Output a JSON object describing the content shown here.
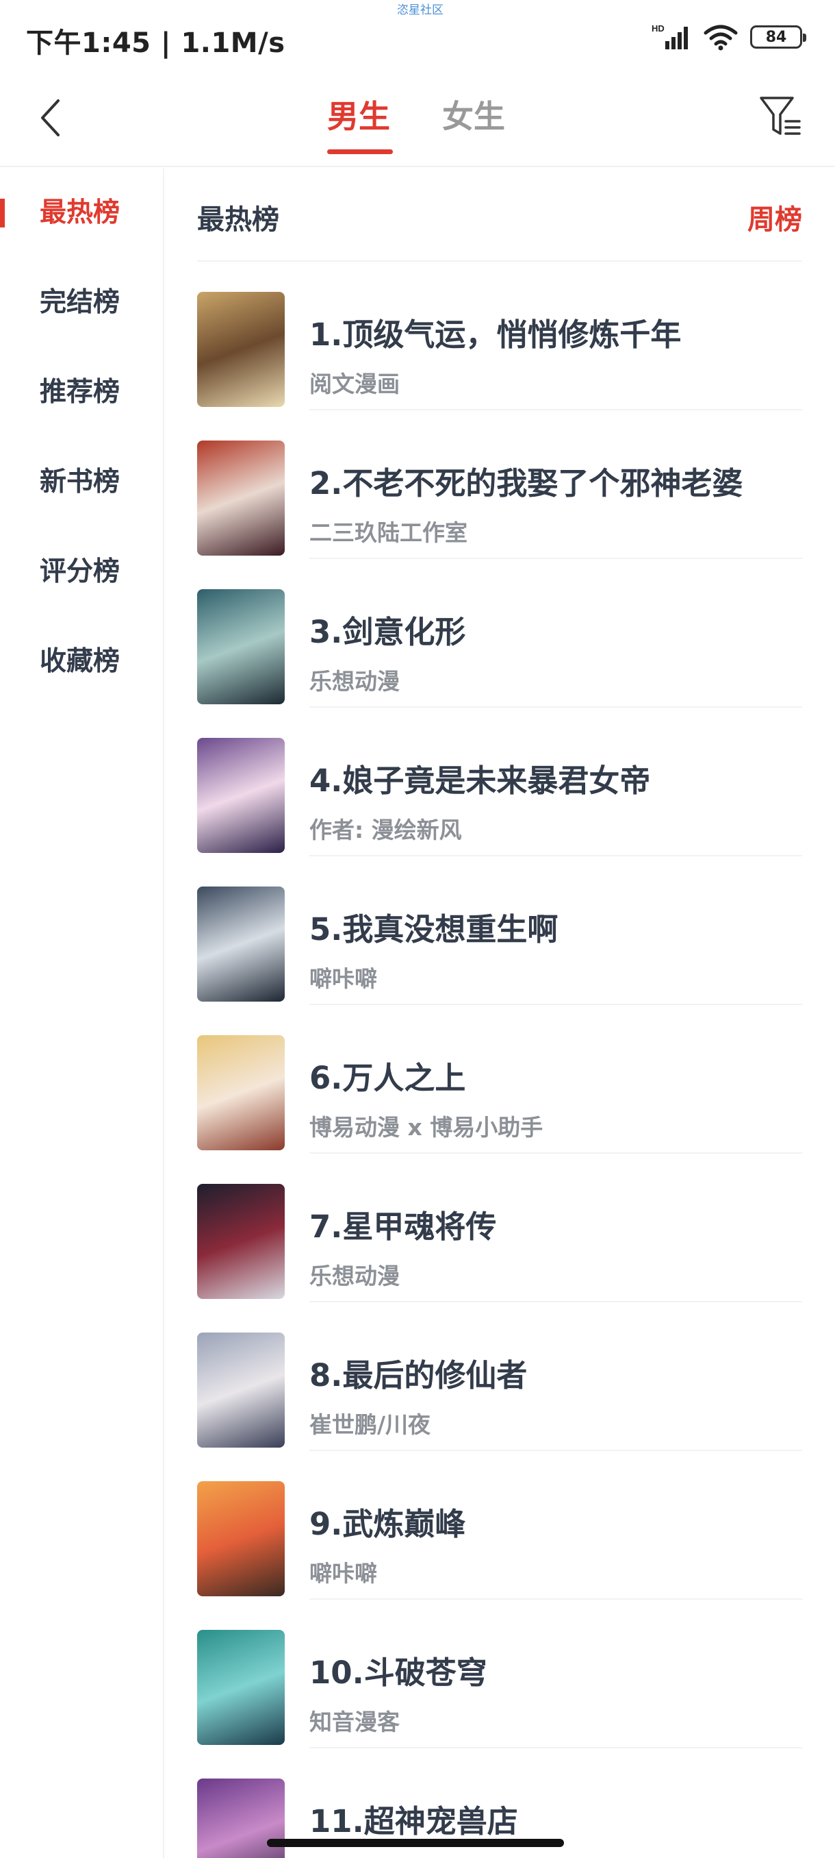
{
  "status_bar": {
    "watermark": "恣星社区",
    "time": "下午1:45 | 1.1M/s",
    "network": "HD",
    "battery": "84"
  },
  "header": {
    "tabs": [
      {
        "label": "男生",
        "active": true
      },
      {
        "label": "女生",
        "active": false
      }
    ],
    "back_icon": "chevron-left-icon",
    "filter_icon": "filter-icon"
  },
  "sidebar": {
    "items": [
      {
        "label": "最热榜",
        "active": true
      },
      {
        "label": "完结榜",
        "active": false
      },
      {
        "label": "推荐榜",
        "active": false
      },
      {
        "label": "新书榜",
        "active": false
      },
      {
        "label": "评分榜",
        "active": false
      },
      {
        "label": "收藏榜",
        "active": false
      }
    ]
  },
  "content": {
    "title": "最热榜",
    "period_label": "周榜"
  },
  "accent_color": "#e03a2f",
  "list": [
    {
      "title": "1.顶级气运，悄悄修炼千年",
      "author": "阅文漫画",
      "colors": [
        "#c9a468",
        "#6b4a2e",
        "#e8d8b0"
      ]
    },
    {
      "title": "2.不老不死的我娶了个邪神老婆",
      "author": "二三玖陆工作室",
      "colors": [
        "#b13a28",
        "#e9d8cf",
        "#3a1a22"
      ]
    },
    {
      "title": "3.剑意化形",
      "author": "乐想动漫",
      "colors": [
        "#2f5f6b",
        "#a7c9c5",
        "#1c2a33"
      ]
    },
    {
      "title": "4.娘子竟是未来暴君女帝",
      "author": "作者: 漫绘新风",
      "colors": [
        "#6a4a8c",
        "#f0d9e9",
        "#2b2048"
      ]
    },
    {
      "title": "5.我真没想重生啊",
      "author": "噼咔噼",
      "colors": [
        "#3b4a5e",
        "#d7dde4",
        "#1d2633"
      ]
    },
    {
      "title": "6.万人之上",
      "author": "博易动漫 x 博易小助手",
      "colors": [
        "#e8c67a",
        "#f4e6d8",
        "#8a3a2a"
      ]
    },
    {
      "title": "7.星甲魂将传",
      "author": "乐想动漫",
      "colors": [
        "#1e1f2e",
        "#8a2a3a",
        "#d8d8e0"
      ]
    },
    {
      "title": "8.最后的修仙者",
      "author": "崔世鹏/川夜",
      "colors": [
        "#9aa3b8",
        "#e9e6ea",
        "#3a3f58"
      ]
    },
    {
      "title": "9.武炼巅峰",
      "author": "噼咔噼",
      "colors": [
        "#f2a24a",
        "#e4603a",
        "#3a2a22"
      ]
    },
    {
      "title": "10.斗破苍穹",
      "author": "知音漫客",
      "colors": [
        "#2a8f8a",
        "#7fd2d0",
        "#1b3a4a"
      ]
    },
    {
      "title": "11.超神宠兽店",
      "author": "",
      "colors": [
        "#6a3a8a",
        "#c88ac8",
        "#2a1a3a"
      ]
    }
  ]
}
